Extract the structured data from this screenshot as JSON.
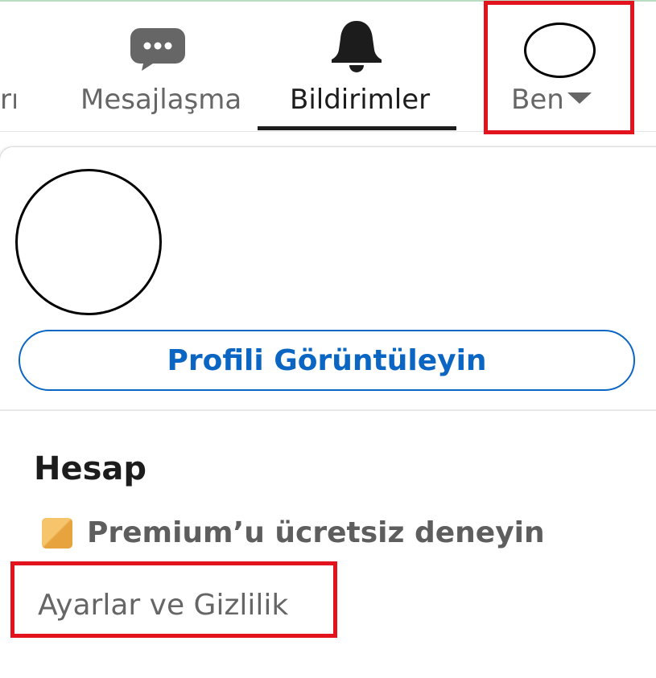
{
  "nav": {
    "partial_label": "rı",
    "messaging_label": "Mesajlaşma",
    "notifications_label": "Bildirimler",
    "me_label": "Ben",
    "active_tab": "notifications",
    "icons": {
      "messaging": "chat-bubble-icon",
      "notifications": "bell-icon",
      "me": "avatar-placeholder",
      "me_menu": "caret-down-icon"
    }
  },
  "profile_menu": {
    "view_profile_label": "Profili Görüntüleyin",
    "account_heading": "Hesap",
    "premium_label": "Premium’u ücretsiz deneyin",
    "premium_icon": "premium-badge-icon",
    "settings_label": "Ayarlar ve Gizlilik"
  },
  "colors": {
    "accent_blue": "#0a66c2",
    "highlight_red": "#e3131d",
    "premium_gold": "#e7a33e",
    "text_dark": "#1c1c1c",
    "text_muted": "#666666"
  }
}
